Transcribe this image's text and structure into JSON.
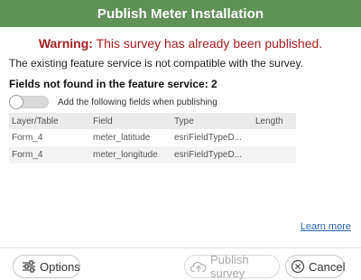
{
  "dialog": {
    "title": "Publish Meter Installation"
  },
  "warning": {
    "lead": "Warning:",
    "message": " This survey has already been published."
  },
  "info_text": "The existing feature service is not compatible with the survey.",
  "fields_not_found": "Fields not found in the feature service: 2",
  "toggle": {
    "label": "Add the following fields when publishing",
    "on": false
  },
  "table": {
    "headers": [
      "Layer/Table",
      "Field",
      "Type",
      "Length"
    ],
    "rows": [
      [
        "Form_4",
        "meter_latitude",
        "esriFieldTypeD...",
        ""
      ],
      [
        "Form_4",
        "meter_longitude",
        "esriFieldTypeD...",
        ""
      ]
    ]
  },
  "learn_more": "Learn more",
  "buttons": {
    "options": "Options",
    "publish": "Publish survey",
    "cancel": "Cancel"
  },
  "colors": {
    "titlebar": "#5f9356",
    "warning": "#a51e1e",
    "link": "#2566b5"
  },
  "icons": {
    "options": "sliders-icon",
    "publish": "cloud-upload-icon",
    "cancel": "close-circle-icon"
  }
}
